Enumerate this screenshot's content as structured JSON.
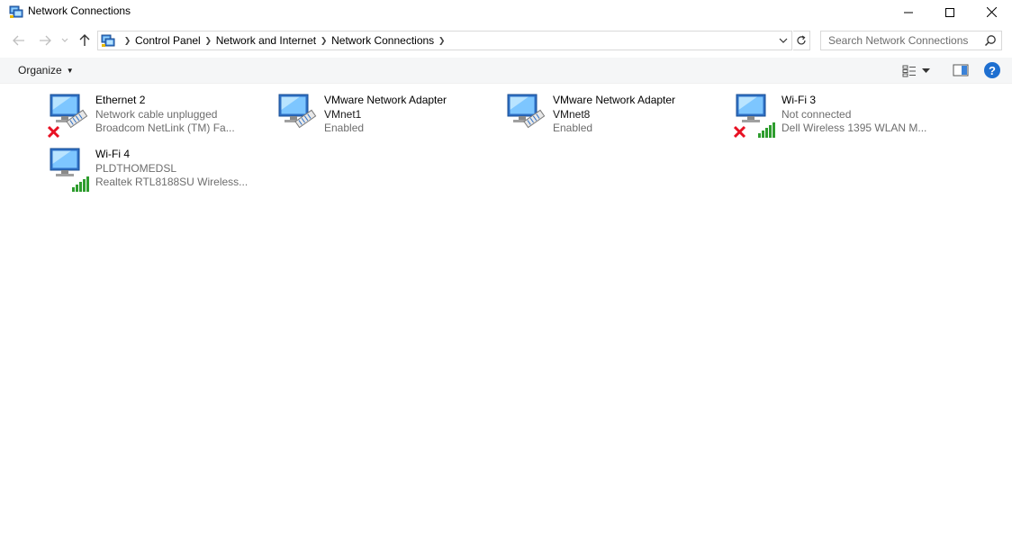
{
  "window": {
    "title": "Network Connections"
  },
  "address": {
    "crumbs": [
      "Control Panel",
      "Network and Internet",
      "Network Connections"
    ]
  },
  "search": {
    "placeholder": "Search Network Connections"
  },
  "toolbar": {
    "organize_label": "Organize"
  },
  "connections": [
    {
      "name": "Ethernet 2",
      "line2": "Network cable unplugged",
      "line3": "Broadcom NetLink (TM) Fa...",
      "type": "ethernet",
      "status": "disconnected"
    },
    {
      "name": "VMware Network Adapter",
      "line2": "VMnet1",
      "line3": "Enabled",
      "type": "ethernet",
      "status": "enabled"
    },
    {
      "name": "VMware Network Adapter",
      "line2": "VMnet8",
      "line3": "Enabled",
      "type": "ethernet",
      "status": "enabled"
    },
    {
      "name": "Wi-Fi 3",
      "line2": "Not connected",
      "line3": "Dell Wireless 1395 WLAN M...",
      "type": "wifi",
      "status": "disconnected"
    },
    {
      "name": "Wi-Fi 4",
      "line2": "PLDTHOMEDSL",
      "line3": "Realtek RTL8188SU Wireless...",
      "type": "wifi",
      "status": "connected"
    }
  ],
  "colors": {
    "help_blue": "#1e6fd0",
    "signal_green": "#2e9d2e",
    "error_red": "#e81123",
    "secondary_text": "#6d6d6d"
  }
}
